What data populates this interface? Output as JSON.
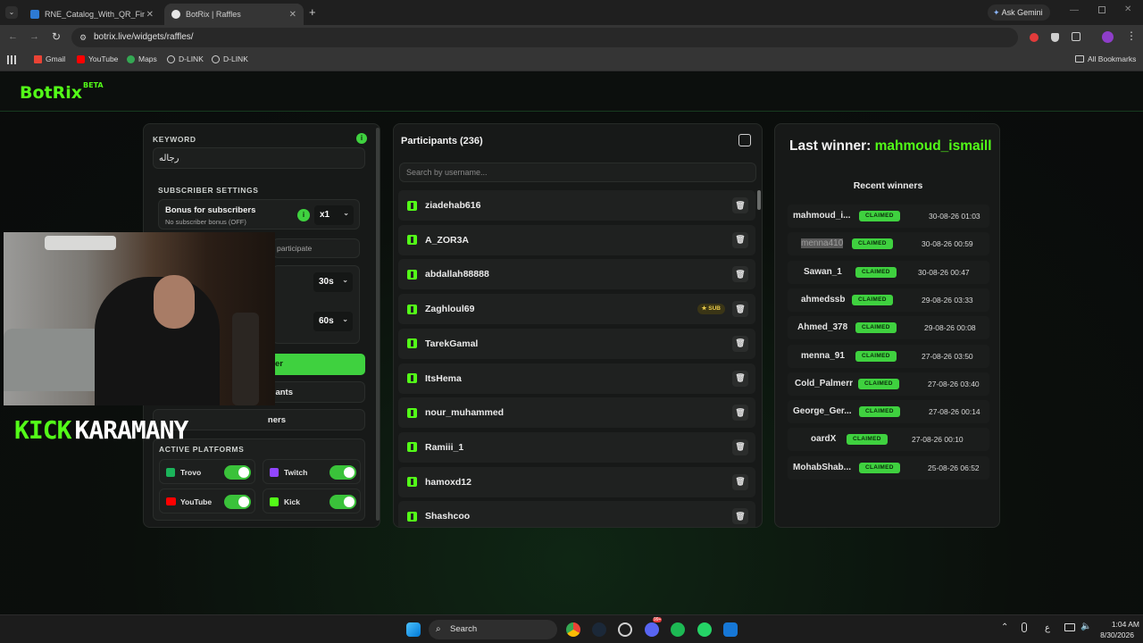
{
  "browser": {
    "tabs": [
      {
        "label": "RNE_Catalog_With_QR_Final.p..."
      },
      {
        "label": "BotRix | Raffles"
      }
    ],
    "ask_gemini": "Ask Gemini",
    "url": "botrix.live/widgets/raffles/",
    "bookmarks": [
      "Gmail",
      "YouTube",
      "Maps",
      "D-LINK",
      "D-LINK"
    ],
    "all_bookmarks": "All Bookmarks"
  },
  "site": {
    "logo": "BotRix",
    "logo_badge": "BETA"
  },
  "settings": {
    "keyword_label": "KEYWORD",
    "keyword_value": "رجاله",
    "subscriber_settings_label": "SUBSCRIBER SETTINGS",
    "bonus_title": "Bonus for subscribers",
    "bonus_sub": "No subscriber bonus (OFF)",
    "multiplier": "x1",
    "participate_text": "participate",
    "time1": "30s",
    "time2": "60s",
    "btn_primary_tail": "er",
    "btn_second_tail": "pants",
    "btn_third_tail": "ners",
    "active_platforms_label": "ACTIVE PLATFORMS",
    "platforms": [
      {
        "name": "Trovo",
        "color": "#1bb35a"
      },
      {
        "name": "Twitch",
        "color": "#9146ff"
      },
      {
        "name": "YouTube",
        "color": "#ff0000"
      },
      {
        "name": "Kick",
        "color": "#53fc18"
      }
    ]
  },
  "overlay": {
    "kick": "KICK",
    "streamer": "KARAMANY"
  },
  "participants": {
    "title": "Participants (236)",
    "search_placeholder": "Search by username...",
    "sub_badge": "SUB",
    "list": [
      "ziadehab616",
      "A_ZOR3A",
      "abdallah88888",
      "Zaghloul69",
      "TarekGamal",
      "ItsHema",
      "nour_muhammed",
      "Ramiii_1",
      "hamoxd12",
      "Shashcoo"
    ]
  },
  "winners": {
    "last_winner_prefix": "Last winner: ",
    "last_winner_name": "mahmoud_ismaill",
    "recent_title": "Recent winners",
    "claimed": "CLAIMED",
    "list": [
      {
        "name": "mahmoud_i...",
        "date": "30-08-26 01:03"
      },
      {
        "name": "menna410",
        "date": "30-08-26 00:59"
      },
      {
        "name": "Sawan_1",
        "date": "30-08-26 00:47"
      },
      {
        "name": "ahmedssb",
        "date": "29-08-26 03:33"
      },
      {
        "name": "Ahmed_378",
        "date": "29-08-26 00:08"
      },
      {
        "name": "menna_91",
        "date": "27-08-26 03:50"
      },
      {
        "name": "Cold_Palmerr",
        "date": "27-08-26 03:40"
      },
      {
        "name": "George_Ger...",
        "date": "27-08-26 00:14"
      },
      {
        "name": "oardX",
        "date": "27-08-26 00:10"
      },
      {
        "name": "MohabShab...",
        "date": "25-08-26 06:52"
      }
    ]
  },
  "taskbar": {
    "search": "Search",
    "lang": "ع",
    "time": "1:04 AM",
    "date": "8/30/2026",
    "discord_badge": "99+"
  }
}
